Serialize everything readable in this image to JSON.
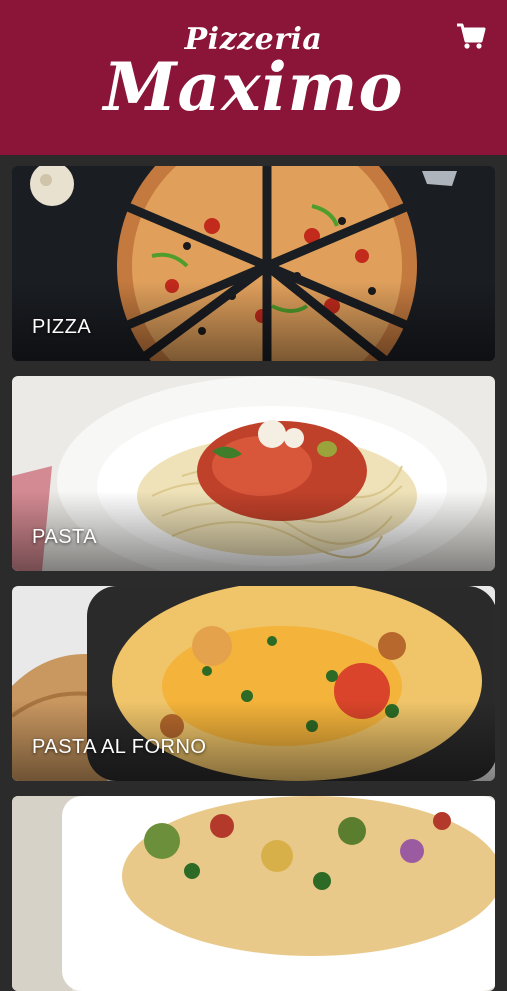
{
  "brand": {
    "small": "Pizzeria",
    "big": "Maximo",
    "header_color": "#8a1538"
  },
  "header": {
    "cart_icon": "shopping-cart-icon"
  },
  "categories": [
    {
      "label": "PIZZA",
      "image": "pizza-photo"
    },
    {
      "label": "PASTA",
      "image": "spaghetti-photo"
    },
    {
      "label": "PASTA AL FORNO",
      "image": "baked-pasta-photo"
    },
    {
      "label": "",
      "image": "baked-vegetables-photo"
    }
  ]
}
